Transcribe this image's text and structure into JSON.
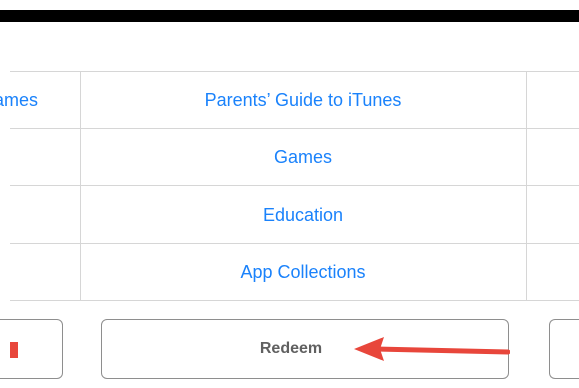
{
  "menu": {
    "left_clipped_label": "Guide to Pre-teen Games",
    "items": [
      {
        "label": "Parents’ Guide to iTunes"
      },
      {
        "label": "Games"
      },
      {
        "label": "Education"
      },
      {
        "label": "App Collections"
      }
    ]
  },
  "buttons": {
    "redeem_label": "Redeem"
  },
  "colors": {
    "link": "#1a82fb",
    "annotation_arrow": "#e8463b"
  }
}
